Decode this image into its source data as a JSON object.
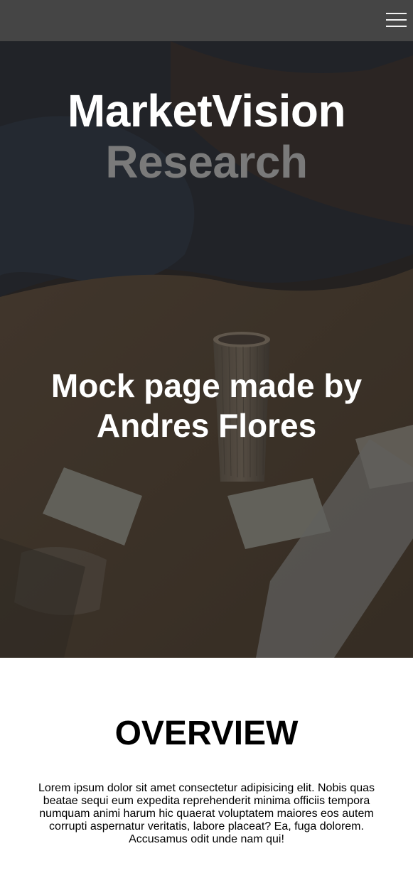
{
  "nav": {
    "menu_icon": "hamburger-menu-icon"
  },
  "hero": {
    "title": "MarketVision",
    "subtitle": "Research",
    "tagline": "Mock page made by Andres Flores"
  },
  "overview": {
    "heading": "OVERVIEW",
    "body": "Lorem ipsum dolor sit amet consectetur adipisicing elit. Nobis quas beatae sequi eum expedita reprehenderit minima officiis tempora numquam animi harum hic quaerat voluptatem maiores eos autem corrupti aspernatur veritatis, labore placeat? Ea, fuga dolorem. Accusamus odit unde nam qui!"
  },
  "colors": {
    "navbar": "#454545",
    "title": "#ffffff",
    "subtitle": "#7a7a7a"
  }
}
